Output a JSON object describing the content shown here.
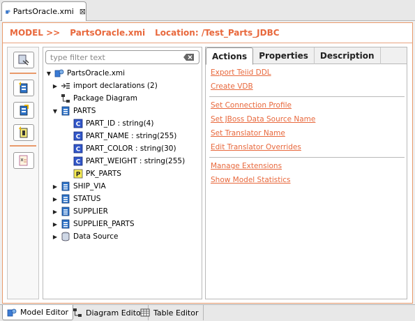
{
  "editor_tab": {
    "title": "PartsOracle.xmi",
    "close_glyph": "⊠"
  },
  "header": {
    "model_label": "MODEL >>",
    "model_name": "PartsOracle.xmi",
    "location": "Location: /Test_Parts_JDBC"
  },
  "filter": {
    "placeholder": "type filter text"
  },
  "tree": {
    "root": "PartsOracle.xmi",
    "items": [
      {
        "label": "import declarations (2)",
        "icon": "import-icon"
      },
      {
        "label": "Package Diagram",
        "icon": "diagram-icon"
      },
      {
        "label": "PARTS",
        "icon": "table-icon"
      },
      {
        "label": "PART_ID : string(4)",
        "icon": "column-icon"
      },
      {
        "label": "PART_NAME : string(255)",
        "icon": "column-icon"
      },
      {
        "label": "PART_COLOR : string(30)",
        "icon": "column-icon"
      },
      {
        "label": "PART_WEIGHT : string(255)",
        "icon": "column-icon"
      },
      {
        "label": "PK_PARTS",
        "icon": "primary-key-icon"
      },
      {
        "label": "SHIP_VIA",
        "icon": "table-icon"
      },
      {
        "label": "STATUS",
        "icon": "table-icon"
      },
      {
        "label": "SUPPLIER",
        "icon": "table-icon"
      },
      {
        "label": "SUPPLIER_PARTS",
        "icon": "table-icon"
      },
      {
        "label": "Data Source",
        "icon": "datasource-icon"
      }
    ]
  },
  "right_tabs": [
    "Actions",
    "Properties",
    "Description"
  ],
  "actions": {
    "group1": [
      "Export Teiid DDL",
      "Create VDB"
    ],
    "group2": [
      "Set Connection Profile",
      "Set JBoss Data Source Name",
      "Set Translator Name",
      "Edit Translator Overrides"
    ],
    "group3": [
      "Manage Extensions",
      "Show Model Statistics"
    ]
  },
  "bottom_tabs": [
    "Model Editor",
    "Diagram Editor",
    "Table Editor"
  ],
  "colors": {
    "accent": "#e8683c",
    "border_accent": "#e99a6b"
  }
}
